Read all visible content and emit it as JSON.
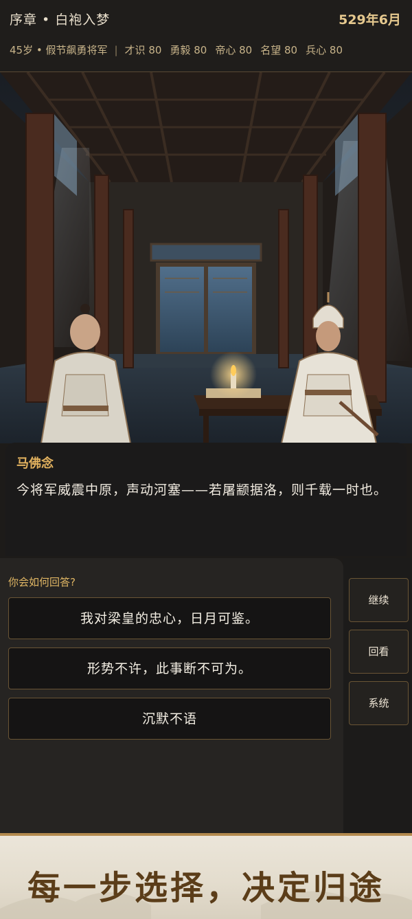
{
  "header": {
    "chapter": "序章 • 白袍入梦",
    "date": "529年6月",
    "profile": "45岁 • 假节飙勇将军",
    "separator": "|",
    "stats": [
      {
        "label": "才识",
        "value": "80"
      },
      {
        "label": "勇毅",
        "value": "80"
      },
      {
        "label": "帝心",
        "value": "80"
      },
      {
        "label": "名望",
        "value": "80"
      },
      {
        "label": "兵心",
        "value": "80"
      }
    ]
  },
  "dialogue": {
    "speaker": "马佛念",
    "text": "今将军威震中原，声动河塞——若屠颛据洛，则千载一时也。"
  },
  "choices": {
    "prompt": "你会如何回答?",
    "options": [
      "我对梁皇的忠心，日月可鉴。",
      "形势不许，此事断不可为。",
      "沉默不语"
    ]
  },
  "sidebar": {
    "continue": "继续",
    "review": "回看",
    "system": "系统"
  },
  "banner": {
    "slogan": "每一步选择，决定归途"
  },
  "colors": {
    "accent": "#e3b25f",
    "border": "#6a5535",
    "banner_text": "#5b3d19"
  }
}
